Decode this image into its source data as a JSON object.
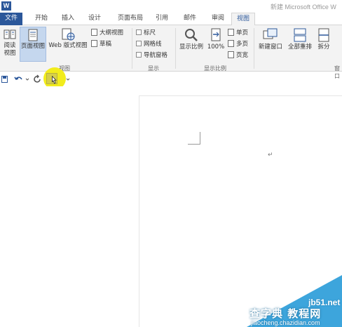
{
  "app": {
    "logo_letter": "W",
    "window_title": "新建 Microsoft Office W"
  },
  "tabs": [
    {
      "label": "文件",
      "state": "file"
    },
    {
      "label": "开始",
      "state": "normal"
    },
    {
      "label": "插入",
      "state": "normal"
    },
    {
      "label": "设计",
      "state": "normal"
    },
    {
      "label": "页面布局",
      "state": "normal"
    },
    {
      "label": "引用",
      "state": "normal"
    },
    {
      "label": "邮件",
      "state": "normal"
    },
    {
      "label": "审阅",
      "state": "normal"
    },
    {
      "label": "视图",
      "state": "active"
    }
  ],
  "ribbon": {
    "views": {
      "group_label": "视图",
      "read_mode": {
        "line1": "阅读",
        "line2": "视图"
      },
      "print_layout": {
        "label": "页面视图",
        "selected": true
      },
      "web_layout": {
        "label": "Web 版式视图"
      },
      "outline": {
        "label": "大纲视图"
      },
      "draft": {
        "label": "草稿"
      }
    },
    "show": {
      "group_label": "显示",
      "ruler": "标尺",
      "gridlines": "网格线",
      "nav_pane": "导航窗格"
    },
    "zoom": {
      "group_label": "显示比例",
      "zoom_btn": "显示比例",
      "hundred": "100%",
      "one_page": "单页",
      "multi_page": "多页",
      "page_width": "页宽"
    },
    "window": {
      "group_label": "窗口",
      "new_window": "新建窗口",
      "arrange_all": "全部重排",
      "split": "拆分"
    }
  },
  "qat": {
    "save_icon": "save-icon",
    "undo_icon": "undo-icon",
    "redo_icon": "redo-icon"
  },
  "document": {
    "paragraph_mark": "↵"
  },
  "watermark": {
    "site": "jb51.net",
    "cn_text": "查字典 教程网",
    "url": "jiaocheng.chazidian.com",
    "color": "#3da5dc"
  },
  "colors": {
    "accent": "#2b579a",
    "highlight": "#f2ec1c"
  }
}
